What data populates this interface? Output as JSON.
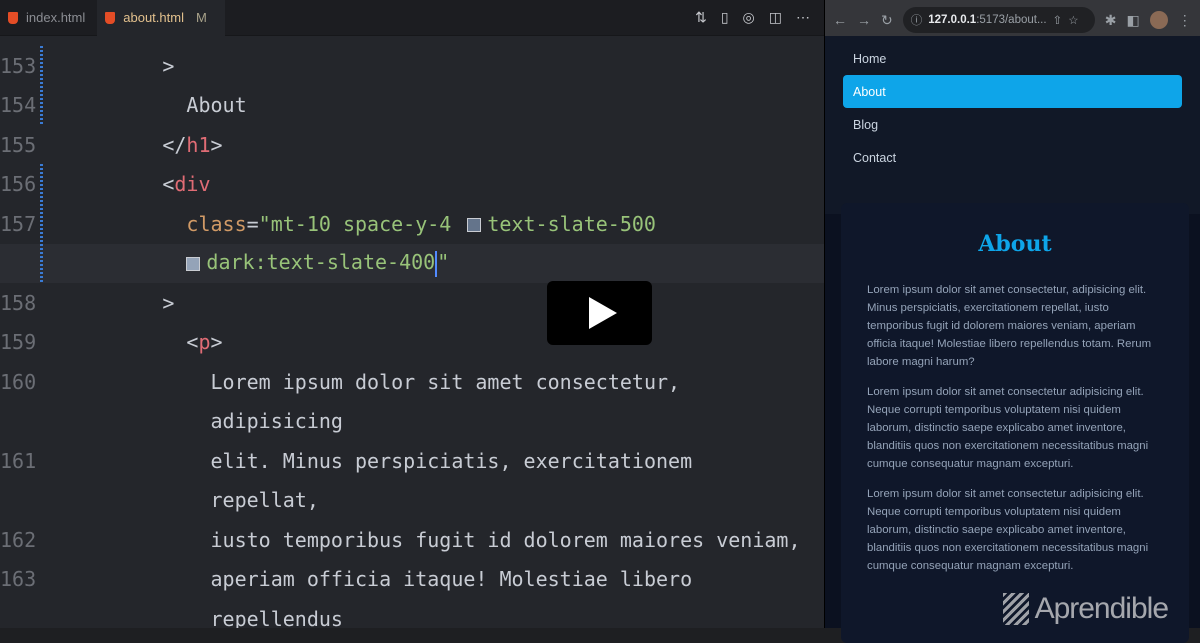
{
  "editor": {
    "tabs": [
      {
        "label": "index.html",
        "modified": ""
      },
      {
        "label": "about.html",
        "modified": "M"
      }
    ],
    "actions": [
      "compare-changes-icon",
      "open-preview-icon",
      "live-server-icon",
      "split-editor-icon",
      "more-icon"
    ],
    "lines": [
      {
        "n": "153",
        "tokens": [
          [
            "t-p",
            "        >"
          ]
        ]
      },
      {
        "n": "154",
        "tokens": [
          [
            "t-txt",
            "          About"
          ]
        ]
      },
      {
        "n": "155",
        "tokens": [
          [
            "t-p",
            "        </"
          ],
          [
            "t-tag",
            "h1"
          ],
          [
            "t-p",
            ">"
          ]
        ]
      },
      {
        "n": "156",
        "tokens": [
          [
            "t-p",
            "        <"
          ],
          [
            "t-tag",
            "div"
          ]
        ]
      },
      {
        "n": "157",
        "tokens": [
          [
            "t-attr",
            "          class"
          ],
          [
            "t-p",
            "="
          ],
          [
            "t-str",
            "\"mt-10 space-y-4 "
          ],
          [
            "sw",
            ""
          ],
          [
            "t-str",
            "text-slate-500"
          ]
        ]
      },
      {
        "n": "",
        "hl": true,
        "tokens": [
          [
            "t-p",
            "          "
          ],
          [
            "swb",
            ""
          ],
          [
            "t-str",
            "dark:text-slate-400"
          ],
          [
            "caret",
            ""
          ],
          [
            "t-str",
            "\""
          ]
        ]
      },
      {
        "n": "158",
        "tokens": [
          [
            "t-p",
            "        >"
          ]
        ]
      },
      {
        "n": "159",
        "tokens": [
          [
            "t-p",
            "          <"
          ],
          [
            "t-tag",
            "p"
          ],
          [
            "t-p",
            ">"
          ]
        ]
      },
      {
        "n": "160",
        "tokens": [
          [
            "t-txt",
            "            Lorem ipsum dolor sit amet consectetur,"
          ]
        ]
      },
      {
        "n": "",
        "tokens": [
          [
            "t-txt",
            "            adipisicing"
          ]
        ]
      },
      {
        "n": "161",
        "tokens": [
          [
            "t-txt",
            "            elit. Minus perspiciatis, exercitationem"
          ]
        ]
      },
      {
        "n": "",
        "tokens": [
          [
            "t-txt",
            "            repellat,"
          ]
        ]
      },
      {
        "n": "162",
        "tokens": [
          [
            "t-txt",
            "            iusto temporibus fugit id dolorem maiores veniam,"
          ]
        ]
      },
      {
        "n": "163",
        "tokens": [
          [
            "t-txt",
            "            aperiam officia itaque! Molestiae libero"
          ]
        ]
      },
      {
        "n": "",
        "tokens": [
          [
            "t-txt",
            "            repellendus"
          ]
        ]
      }
    ]
  },
  "browser": {
    "url_host": "127.0.0.1",
    "url_rest": ":5173/about...",
    "nav": [
      {
        "label": "Home",
        "active": false
      },
      {
        "label": "About",
        "active": true
      },
      {
        "label": "Blog",
        "active": false
      },
      {
        "label": "Contact",
        "active": false
      }
    ],
    "title": "About",
    "paragraphs": [
      "Lorem ipsum dolor sit amet consectetur, adipisicing elit. Minus perspiciatis, exercitationem repellat, iusto temporibus fugit id dolorem maiores veniam, aperiam officia itaque! Molestiae libero repellendus totam. Rerum labore magni harum?",
      "Lorem ipsum dolor sit amet consectetur adipisicing elit. Neque corrupti temporibus voluptatem nisi quidem laborum, distinctio saepe explicabo amet inventore, blanditiis quos non exercitationem necessitatibus magni cumque consequatur magnam excepturi.",
      "Lorem ipsum dolor sit amet consectetur adipisicing elit. Neque corrupti temporibus voluptatem nisi quidem laborum, distinctio saepe explicabo amet inventore, blanditiis quos non exercitationem necessitatibus magni cumque consequatur magnam excepturi."
    ]
  },
  "watermark": "Aprendible"
}
